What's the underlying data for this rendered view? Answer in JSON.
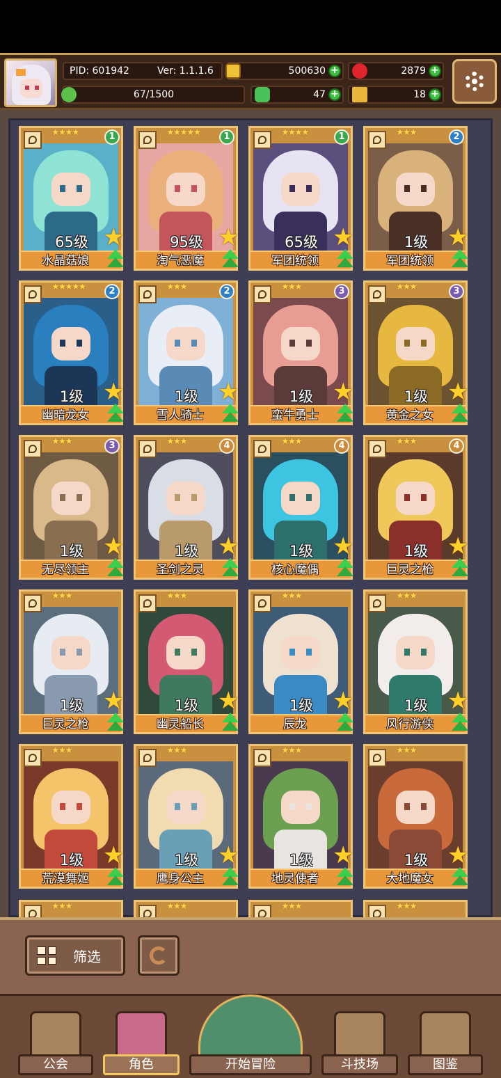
{
  "header": {
    "pid_label": "PID: 601942",
    "version_label": "Ver: 1.1.1.6",
    "gold": "500630",
    "gems": "2879",
    "stamina": "67/1500",
    "clover": "47",
    "keys": "18"
  },
  "characters": [
    {
      "name": "水晶菇娘",
      "level": "65级",
      "stars": "★★★★",
      "rank": "1",
      "rank_color": "#3aa84f",
      "palette": [
        "#5ab0c9",
        "#8fe3d4",
        "#2c6a88"
      ]
    },
    {
      "name": "淘气恶魔",
      "level": "95级",
      "stars": "★★★★★",
      "rank": "1",
      "rank_color": "#3aa84f",
      "palette": [
        "#e7a8a4",
        "#e9b07c",
        "#c4555b"
      ]
    },
    {
      "name": "军团统领",
      "level": "65级",
      "stars": "★★★★",
      "rank": "1",
      "rank_color": "#3aa84f",
      "palette": [
        "#5b4f7e",
        "#e6e4f2",
        "#3a2f5a"
      ]
    },
    {
      "name": "军团统领",
      "level": "1级",
      "stars": "★★★",
      "rank": "2",
      "rank_color": "#2f7fc4",
      "palette": [
        "#7a5e4a",
        "#d8b27a",
        "#4a2f24"
      ]
    },
    {
      "name": "幽暗龙女",
      "level": "1级",
      "stars": "★★★★★",
      "rank": "2",
      "rank_color": "#2f7fc4",
      "palette": [
        "#2a5f8a",
        "#2a7fbf",
        "#1c3658"
      ]
    },
    {
      "name": "雪人骑士",
      "level": "1级",
      "stars": "★★★",
      "rank": "2",
      "rank_color": "#2f7fc4",
      "palette": [
        "#7fb1d6",
        "#e9eef6",
        "#5a8bb6"
      ]
    },
    {
      "name": "蛮牛勇士",
      "level": "1级",
      "stars": "★★★",
      "rank": "3",
      "rank_color": "#7b5bb0",
      "palette": [
        "#7a4a4e",
        "#e79c94",
        "#5b3a3a"
      ]
    },
    {
      "name": "黄金之女",
      "level": "1级",
      "stars": "★★★",
      "rank": "3",
      "rank_color": "#7b5bb0",
      "palette": [
        "#6b5230",
        "#e6b840",
        "#8a6a24"
      ]
    },
    {
      "name": "无尽领主",
      "level": "1级",
      "stars": "★★★",
      "rank": "3",
      "rank_color": "#7b5bb0",
      "palette": [
        "#6f5a44",
        "#d9b98a",
        "#8a6e50"
      ]
    },
    {
      "name": "圣剑之灵",
      "level": "1级",
      "stars": "★★★",
      "rank": "4",
      "rank_color": "#c98a3a",
      "palette": [
        "#4e4e5e",
        "#d9dde6",
        "#b99a6a"
      ]
    },
    {
      "name": "核心魔偶",
      "level": "1级",
      "stars": "★★★",
      "rank": "4",
      "rank_color": "#c98a3a",
      "palette": [
        "#2a5060",
        "#3cc4e0",
        "#2c6f6c"
      ]
    },
    {
      "name": "巨灵之枪",
      "level": "1级",
      "stars": "★★★",
      "rank": "4",
      "rank_color": "#c98a3a",
      "palette": [
        "#5a3a2a",
        "#f0c85a",
        "#8a2f2a"
      ]
    },
    {
      "name": "巨灵之枪",
      "level": "1级",
      "stars": "★★★",
      "rank": "",
      "rank_color": "",
      "palette": [
        "#5a6e7e",
        "#e6ecf2",
        "#8a9aae"
      ]
    },
    {
      "name": "幽灵船长",
      "level": "1级",
      "stars": "★★★",
      "rank": "",
      "rank_color": "",
      "palette": [
        "#2f4a3a",
        "#d45a74",
        "#3f7a5e"
      ]
    },
    {
      "name": "辰龙",
      "level": "1级",
      "stars": "★★★",
      "rank": "",
      "rank_color": "",
      "palette": [
        "#3e5c78",
        "#efe1cf",
        "#3a8ac4"
      ]
    },
    {
      "name": "风行游侠",
      "level": "1级",
      "stars": "★★★",
      "rank": "",
      "rank_color": "",
      "palette": [
        "#4a5a4a",
        "#f2ecea",
        "#2f7a6a"
      ]
    },
    {
      "name": "荒漠舞姬",
      "level": "1级",
      "stars": "★★★",
      "rank": "",
      "rank_color": "",
      "palette": [
        "#7a3a2a",
        "#f3c46a",
        "#c24a3a"
      ]
    },
    {
      "name": "鹰身公主",
      "level": "1级",
      "stars": "★★★",
      "rank": "",
      "rank_color": "",
      "palette": [
        "#5a6a7a",
        "#f0dcb0",
        "#6aa0b6"
      ]
    },
    {
      "name": "地灵使者",
      "level": "1级",
      "stars": "★★★",
      "rank": "",
      "rank_color": "",
      "palette": [
        "#4a3a4e",
        "#6aa050",
        "#e8e4e0"
      ]
    },
    {
      "name": "大地魔女",
      "level": "1级",
      "stars": "★★★",
      "rank": "",
      "rank_color": "",
      "palette": [
        "#6a3e2e",
        "#c86a3a",
        "#8a4a36"
      ]
    }
  ],
  "peek_row_stars": [
    "★★★",
    "★★★",
    "★★★",
    "★★★"
  ],
  "controls": {
    "filter_label": "筛选"
  },
  "nav": {
    "guild": "公会",
    "character": "角色",
    "adventure": "开始冒险",
    "arena": "斗技场",
    "codex": "图鉴"
  }
}
